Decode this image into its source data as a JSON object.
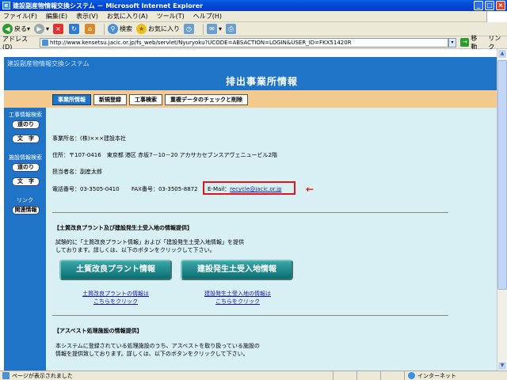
{
  "window": {
    "title": "建設副産物情報交換システム － Microsoft Internet Explorer",
    "btn_min": "_",
    "btn_max": "□",
    "btn_close": "×"
  },
  "menu": [
    "ファイル(F)",
    "編集(E)",
    "表示(V)",
    "お気に入り(A)",
    "ツール(T)",
    "ヘルプ(H)"
  ],
  "toolbar": {
    "back": "戻る",
    "back_glyph": "◀",
    "forward_glyph": "▶",
    "stop_glyph": "×",
    "refresh_glyph": "↻",
    "home_glyph": "⌂",
    "search": "検索",
    "search_glyph": "⚲",
    "favorites": "お気に入り",
    "favorites_glyph": "★",
    "history_glyph": "◷",
    "mail_glyph": "✉",
    "print_glyph": "⎙",
    "dropdown_glyph": "▾"
  },
  "address": {
    "label": "アドレス(D)",
    "url": "http://www.kensetsu.jacic.or.jp/fs_web/servlet/Nyuryoku?UCODE=ABSACTION=LOGIN&USER_ID=FKX51420R",
    "go_label": "移動",
    "go_glyph": "→",
    "links_label": "リンク"
  },
  "site": {
    "system_name": "建設副産物情報交換システム",
    "page_title": "排出事業所情報"
  },
  "nav_tabs": [
    "事業所情報",
    "新規登録",
    "工事検索",
    "重複データのチェックと削除"
  ],
  "sidebar": {
    "construction_search": "工事情報検索",
    "facility_search": "施設情報検索",
    "link_header": "リンク",
    "btn_road": "道のり",
    "btn_text": "文　字",
    "btn_related": "関連情報"
  },
  "office": {
    "name": "事業所名：(株)×××建設本社",
    "address": "住所：〒107-0416　東京都 港区 赤坂7－10－20 アカサカセブンスアヴェニュービル2階",
    "contact": "担当者名：副産太郎",
    "phone": "電話番号：03-3505-0410",
    "fax": "FAX番号：03-3505-8872",
    "email_label": "E-Mail：",
    "email": "recycle@jacic.or.jp"
  },
  "arrow": "←",
  "plant_section": {
    "heading": "【土質改良プラント及び建設発生土受入地の情報提供】",
    "desc_line1": "試験的に「土質改良プラント情報」および「建設発生土受入地情報」を提供",
    "desc_line2": "しております。詳しくは、以下のボタンをクリックして下さい。",
    "btn_plant": "土質改良プラント情報",
    "btn_receive": "建設発生土受入地情報",
    "link_plant_line1": "土質改良プラントの情報は",
    "link_plant_line2": "こちらをクリック",
    "link_receive_line1": "建設発生土受入地の情報は",
    "link_receive_line2": "こちらをクリック"
  },
  "asbestos_section": {
    "heading": "【アスベスト処理施設の情報提供】",
    "desc_line1": "本システムに登録されている処理施設のうち、アスベストを取り扱っている施設の",
    "desc_line2": "情報を提供致しております。詳しくは、以下のボタンをクリックして下さい。"
  },
  "status": {
    "text": "ページが表示されました",
    "zone": "インターネット"
  }
}
